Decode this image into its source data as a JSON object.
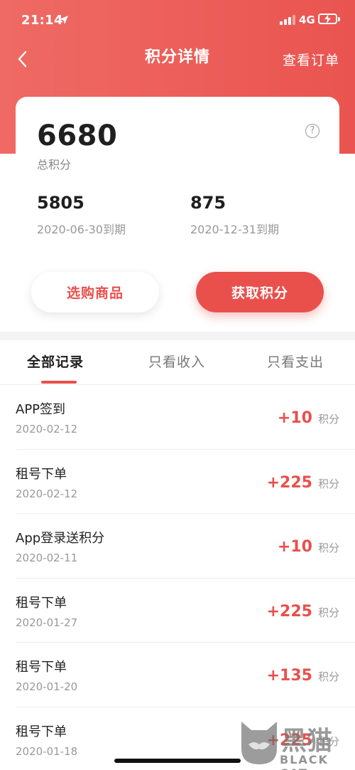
{
  "status_bar": {
    "time": "21:14",
    "network": "4G"
  },
  "nav": {
    "title": "积分详情",
    "right_link": "查看订单"
  },
  "points": {
    "total": "6680",
    "total_label": "总积分",
    "expiring": [
      {
        "value": "5805",
        "date": "2020-06-30到期"
      },
      {
        "value": "875",
        "date": "2020-12-31到期"
      }
    ]
  },
  "actions": {
    "shop": "选购商品",
    "earn": "获取积分"
  },
  "tabs": [
    {
      "label": "全部记录",
      "active": true
    },
    {
      "label": "只看收入",
      "active": false
    },
    {
      "label": "只看支出",
      "active": false
    }
  ],
  "records": [
    {
      "title": "APP签到",
      "date": "2020-02-12",
      "amount": "+10",
      "unit": "积分"
    },
    {
      "title": "租号下单",
      "date": "2020-02-12",
      "amount": "+225",
      "unit": "积分"
    },
    {
      "title": "App登录送积分",
      "date": "2020-02-11",
      "amount": "+10",
      "unit": "积分"
    },
    {
      "title": "租号下单",
      "date": "2020-01-27",
      "amount": "+225",
      "unit": "积分"
    },
    {
      "title": "租号下单",
      "date": "2020-01-20",
      "amount": "+135",
      "unit": "积分"
    },
    {
      "title": "租号下单",
      "date": "2020-01-18",
      "amount": "+225",
      "unit": "积分"
    }
  ],
  "watermark": {
    "text": "黑猫",
    "sub": "BLACK CAT"
  },
  "colors": {
    "accent": "#e9504c",
    "header": "#ec5e59"
  },
  "icons": [
    "location-arrow-icon",
    "signal-icon",
    "battery-icon",
    "back-chevron-icon",
    "help-icon",
    "black-cat-logo-icon"
  ]
}
